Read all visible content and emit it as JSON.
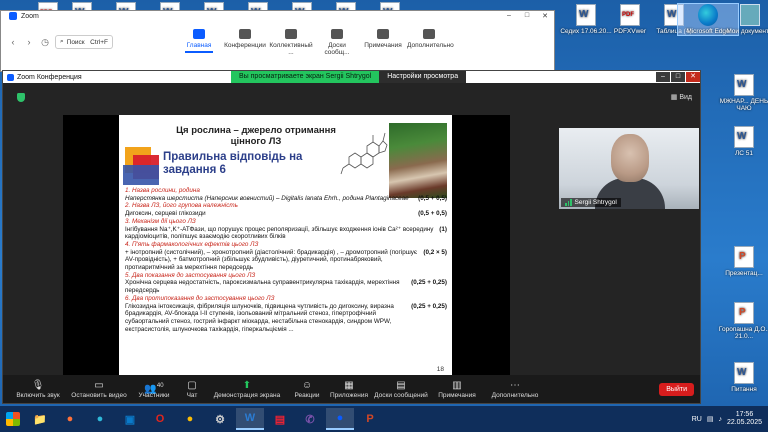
{
  "desktop": {
    "icons": [
      {
        "label": "",
        "type": "pdf"
      },
      {
        "label": "",
        "type": "word"
      },
      {
        "label": "",
        "type": "word"
      },
      {
        "label": "",
        "type": "word"
      },
      {
        "label": "",
        "type": "word"
      },
      {
        "label": "",
        "type": "word"
      },
      {
        "label": "",
        "type": "word"
      },
      {
        "label": "",
        "type": "word"
      },
      {
        "label": "",
        "type": "word"
      },
      {
        "label": "Седих 17.06.20...",
        "type": "word"
      },
      {
        "label": "PDFXVwer",
        "type": "pdf"
      },
      {
        "label": "Таблица (4)",
        "type": "word"
      },
      {
        "label": "Microsoft Edge",
        "type": "edge"
      },
      {
        "label": "Мои документы",
        "type": "pc"
      },
      {
        "label": "МЖНАР... ДЕНЬ ЧАЮ",
        "type": "word"
      },
      {
        "label": "ЛС 51",
        "type": "word"
      },
      {
        "label": "Презентац...",
        "type": "ppt"
      },
      {
        "label": "Горопашна Д.О., 21.0...",
        "type": "ppt"
      },
      {
        "label": "Питання",
        "type": "word"
      }
    ]
  },
  "zoom_main": {
    "title": "Zoom",
    "search_label": "Поиск",
    "search_shortcut": "Ctrl+F",
    "tabs": [
      {
        "label": "Главная",
        "active": true
      },
      {
        "label": "Конференции",
        "active": false
      },
      {
        "label": "Коллективный ...",
        "active": false
      },
      {
        "label": "Доски сообщ...",
        "active": false
      },
      {
        "label": "Примечания",
        "active": false
      },
      {
        "label": "Дополнительно",
        "active": false
      }
    ]
  },
  "meeting": {
    "title": "Zoom Конференция",
    "share_notice": "Вы просматриваете экран Sergiі Shtrygol",
    "view_options": "Настройки просмотра",
    "view_label": "Вид",
    "participant_name": "Sergiі Shtrygol",
    "controls": [
      {
        "label": "Включить звук",
        "icon": "mic-muted-icon"
      },
      {
        "label": "Остановить видео",
        "icon": "video-icon"
      },
      {
        "label": "Участники",
        "icon": "participants-icon",
        "count": "40"
      },
      {
        "label": "Чат",
        "icon": "chat-icon"
      },
      {
        "label": "Демонстрация экрана",
        "icon": "share-icon"
      },
      {
        "label": "Реакции",
        "icon": "reactions-icon"
      },
      {
        "label": "Приложения",
        "icon": "apps-icon"
      },
      {
        "label": "Доски сообщений",
        "icon": "whiteboard-icon"
      },
      {
        "label": "Примечания",
        "icon": "notes-icon"
      },
      {
        "label": "Дополнительно",
        "icon": "more-icon"
      }
    ],
    "leave_label": "Выйти"
  },
  "slide": {
    "title": "Ця рослина – джерело отримання цінного ЛЗ",
    "subtitle": "Правильна відповідь на завдання 6",
    "items": [
      {
        "head": "1.     Назва рослини, родина",
        "body": "Наперстянка шерстиста (Наперсник вовнистий) – Digitalis lanata Ehrh., родина  Plantaginaceae",
        "score": "(0,5 + 0,5)"
      },
      {
        "head": "2. Назва ЛЗ, його групова належність",
        "body": "Дигоксин, серцеві глікозиди",
        "score": "(0,5 + 0,5)"
      },
      {
        "head": "3. Механізм дії цього ЛЗ",
        "body": "Інгібування Na⁺,K⁺-АТФази, що порушує процес реполяризації, збільшує входження іонів Ca²⁺ всередину кардіоміоцитів, поліпшує взаємодію скоротливих білків",
        "score": "(1)"
      },
      {
        "head": "4. П'ять фармакологічних ефектів цього ЛЗ",
        "body": "+ інотропний (систолічний), – хронотропний (діастолічний: брадикардія) , – дромотропний (погіршує AV-провідність), + батмотропний (збільшує збудливість), діуретичний, протинабряковий, протиаритмічний  за мерехтіння передсердь",
        "score": "(0,2 × 5)"
      },
      {
        "head": "5. Два показання до застосування цього ЛЗ",
        "body": "Хронічна серцева недостатність, пароксизмальна суправентрикулярна тахікардія, мерехтіння передсердь",
        "score": "(0,25 + 0,25)"
      },
      {
        "head": "6. Два протипоказання до застосування цього ЛЗ",
        "body": "Глікозидна інтоксикація, фібриляція шлуночків, підвищена чутливість до дигоксину, виразна брадикардія, AV-блокада I-II ступенів, ізольований мітральний стеноз, гіпертрофічний субаортальний стеноз, гострий інфаркт міокарда, нестабільна стенокардія, синдром WPW, екстрасистолія, шлуночкова тахікардія, гіперкальціємія ...",
        "score": "(0,25 + 0,25)"
      }
    ],
    "page_number": "18"
  },
  "taskbar": {
    "apps": [
      "explorer-icon",
      "firefox-icon",
      "edge-icon",
      "store-icon",
      "opera-icon",
      "chrome-icon",
      "settings-icon",
      "word-icon",
      "pdf-icon",
      "viber-icon",
      "zoom-icon",
      "powerpoint-icon"
    ],
    "language": "RU",
    "time": "17:56",
    "date": "22.05.2025"
  }
}
